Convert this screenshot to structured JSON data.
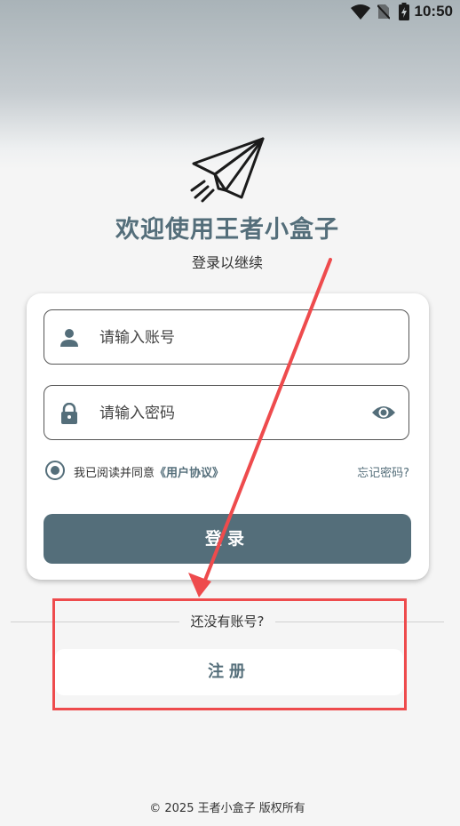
{
  "status_bar": {
    "time": "10:50",
    "icons": [
      "wifi-icon",
      "no-sim-icon",
      "battery-charging-icon"
    ]
  },
  "app": {
    "logo_icon": "paper-plane-icon",
    "welcome_title": "欢迎使用王者小盒子",
    "subtitle": "登录以继续"
  },
  "login_form": {
    "account_placeholder": "请输入账号",
    "password_placeholder": "请输入密码",
    "agree_prefix": "我已阅读并同意",
    "agreement_link": "《用户协议》",
    "agree_checked": true,
    "forgot_password": "忘记密码?",
    "login_button": "登录"
  },
  "register": {
    "prompt": "还没有账号?",
    "button": "注册"
  },
  "footer": {
    "copyright": "© 2025 王者小盒子 版权所有"
  },
  "colors": {
    "primary": "#546e7a",
    "annotation": "#ee4b4d",
    "background": "#f5f5f5"
  }
}
